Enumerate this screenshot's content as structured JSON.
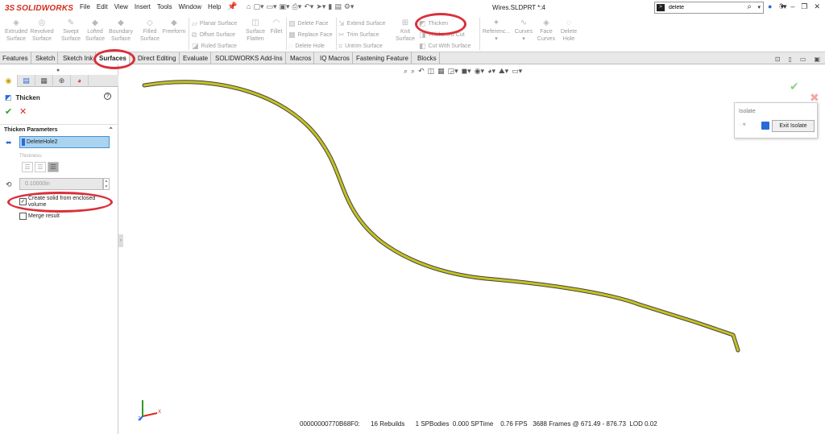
{
  "app": {
    "logo_ds": "3S",
    "logo_name": "SOLIDWORKS",
    "document_title": "Wires.SLDPRT *:4"
  },
  "menu": [
    "File",
    "Edit",
    "View",
    "Insert",
    "Tools",
    "Window",
    "Help"
  ],
  "search": {
    "value": "delete",
    "cmd_glyph": ">"
  },
  "window_controls": {
    "minimize": "–",
    "restore": "❐",
    "close": "✕",
    "help": "?",
    "user": "👤"
  },
  "ribbon": {
    "large_tools": [
      {
        "name": "extruded-surface",
        "label1": "Extruded",
        "label2": "Surface",
        "icon": "◈"
      },
      {
        "name": "revolved-surface",
        "label1": "Revolved",
        "label2": "Surface",
        "icon": "◎"
      },
      {
        "name": "swept-surface",
        "label1": "Swept",
        "label2": "Surface",
        "icon": "✎"
      },
      {
        "name": "lofted-surface",
        "label1": "Lofted",
        "label2": "Surface",
        "icon": "◆"
      },
      {
        "name": "boundary-surface",
        "label1": "Boundary",
        "label2": "Surface",
        "icon": "◆"
      },
      {
        "name": "filled-surface",
        "label1": "Filled",
        "label2": "Surface",
        "icon": "◇"
      },
      {
        "name": "freeform",
        "label1": "Freeform",
        "label2": "",
        "icon": "◆"
      }
    ],
    "col1": [
      "Planar Surface",
      "Offset Surface",
      "Ruled Surface"
    ],
    "surface_flatten": {
      "label1": "Surface",
      "label2": "Flatten"
    },
    "fillet": "Fillet",
    "col2": [
      "Delete Face",
      "Replace Face",
      "Delete Hole"
    ],
    "col3": [
      "Extend Surface",
      "Trim Surface",
      "Untrim Surface"
    ],
    "knit": {
      "label1": "Knit",
      "label2": "Surface"
    },
    "col4": [
      "Thicken",
      "Thickened Cut",
      "Cut With Surface"
    ],
    "reference": "Referenc...",
    "curves": "Curves",
    "face_curves": {
      "label1": "Face",
      "label2": "Curves"
    },
    "delete_hole": {
      "label1": "Delete",
      "label2": "Hole"
    }
  },
  "tabs": [
    {
      "label": "Features",
      "active": false
    },
    {
      "label": "Sketch",
      "active": false
    },
    {
      "label": "Sketch Ink",
      "active": false
    },
    {
      "label": "Surfaces",
      "active": true
    },
    {
      "label": "Direct Editing",
      "active": false
    },
    {
      "label": "Evaluate",
      "active": false
    },
    {
      "label": "SOLIDWORKS Add-Ins",
      "active": false
    },
    {
      "label": "Macros",
      "active": false
    },
    {
      "label": "IQ Macros",
      "active": false
    },
    {
      "label": "Fastening Feature",
      "active": false
    },
    {
      "label": "Blocks",
      "active": false
    }
  ],
  "property_manager": {
    "title": "Thicken",
    "group_title": "Thicken Parameters",
    "selection": "DeleteHole2",
    "thickness_label": "Thickness:",
    "thickness_value": "0.10000in",
    "options": [
      {
        "label": "Create solid from enclosed volume",
        "checked": true
      },
      {
        "label": "Merge result",
        "checked": false
      }
    ]
  },
  "isolate": {
    "title": "Isolate",
    "exit_label": "Exit Isolate"
  },
  "status_bar": "00000000770B68F0:      16 Rebuilds      1 SPBodies  0.000 SPTime    0.76 FPS   3688 Frames @ 671.49 - 876.73  LOD 0.02",
  "colors": {
    "accent_red": "#d9303a",
    "brand_red": "#d52b1e",
    "ok_green": "#2d9a2d",
    "curve_fill": "#b7b21f",
    "selection_blue": "#aad3f0"
  }
}
